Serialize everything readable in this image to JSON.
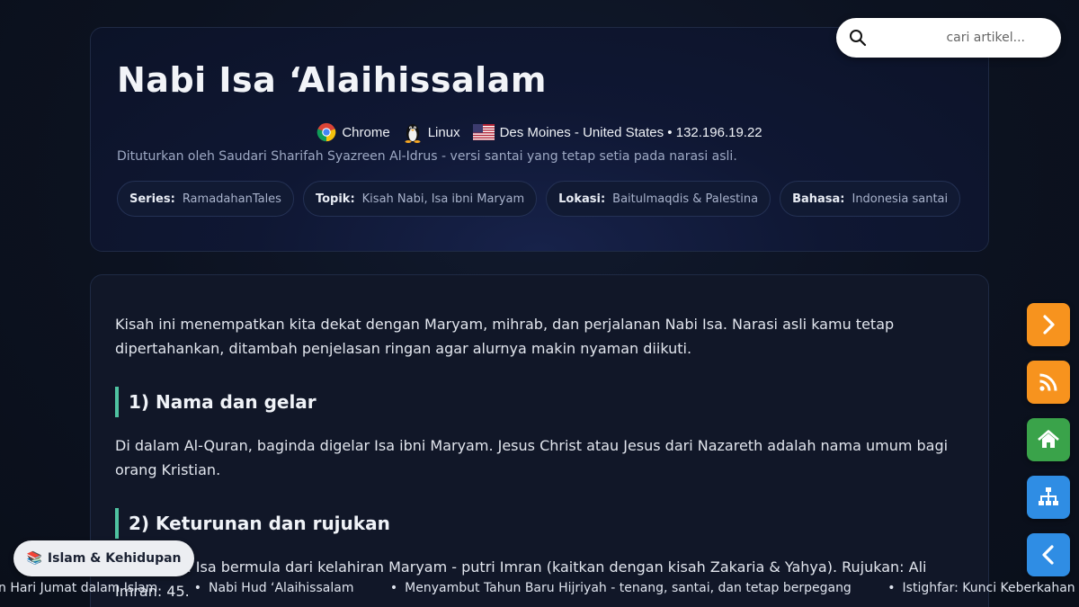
{
  "header": {
    "title": "Nabi Isa ‘Alaihissalam",
    "meta": {
      "browser": "Chrome",
      "os": "Linux",
      "location": "Des Moines - United States • 132.196.19.22"
    },
    "subtitle": "Dituturkan oleh Saudari Sharifah Syazreen Al-Idrus - versi santai yang tetap setia pada narasi asli.",
    "chips": [
      {
        "key": "Series:",
        "value": "RamadahanTales"
      },
      {
        "key": "Topik:",
        "value": "Kisah Nabi, Isa ibni Maryam"
      },
      {
        "key": "Lokasi:",
        "value": "Baitulmaqdis & Palestina"
      },
      {
        "key": "Bahasa:",
        "value": "Indonesia santai"
      }
    ]
  },
  "search": {
    "placeholder": "cari artikel...",
    "value": ""
  },
  "content": {
    "intro": "Kisah ini menempatkan kita dekat dengan Maryam, mihrab, dan perjalanan Nabi Isa. Narasi asli kamu tetap dipertahankan, ditambah penjelasan ringan agar alurnya makin nyaman diikuti.",
    "sections": [
      {
        "heading": "1) Nama dan gelar",
        "text": "Di dalam Al-Quran, baginda digelar Isa ibni Maryam. Jesus Christ atau Jesus dari Nazareth adalah nama umum bagi orang Kristian."
      },
      {
        "heading": "2) Keturunan dan rujukan",
        "text": "Kisah Nabi Isa bermula dari kelahiran Maryam - putri Imran (kaitkan dengan kisah Zakaria & Yahya). Rujukan: Ali Imran: 45."
      }
    ]
  },
  "category_pill": {
    "icon": "books-icon",
    "label": "Islam & Kehidupan"
  },
  "ticker": [
    "wwaan Hari Jumat dalam Islam",
    "Nabi Hud ‘Alaihissalam",
    "Menyambut Tahun Baru Hijriyah - tenang, santai, dan tetap berpegang",
    "Istighfar: Kunci Keberkahan dan"
  ],
  "side_buttons": [
    {
      "icon": "chevron-right-icon",
      "color": "#f7931e"
    },
    {
      "icon": "rss-icon",
      "color": "#f7931e"
    },
    {
      "icon": "home-icon",
      "color": "#3aa34a"
    },
    {
      "icon": "sitemap-icon",
      "color": "#2f8de4"
    },
    {
      "icon": "chevron-left-icon",
      "color": "#2f8de4"
    }
  ],
  "colors": {
    "accent_border": "#4fc3a1",
    "background": "#0c1220"
  }
}
